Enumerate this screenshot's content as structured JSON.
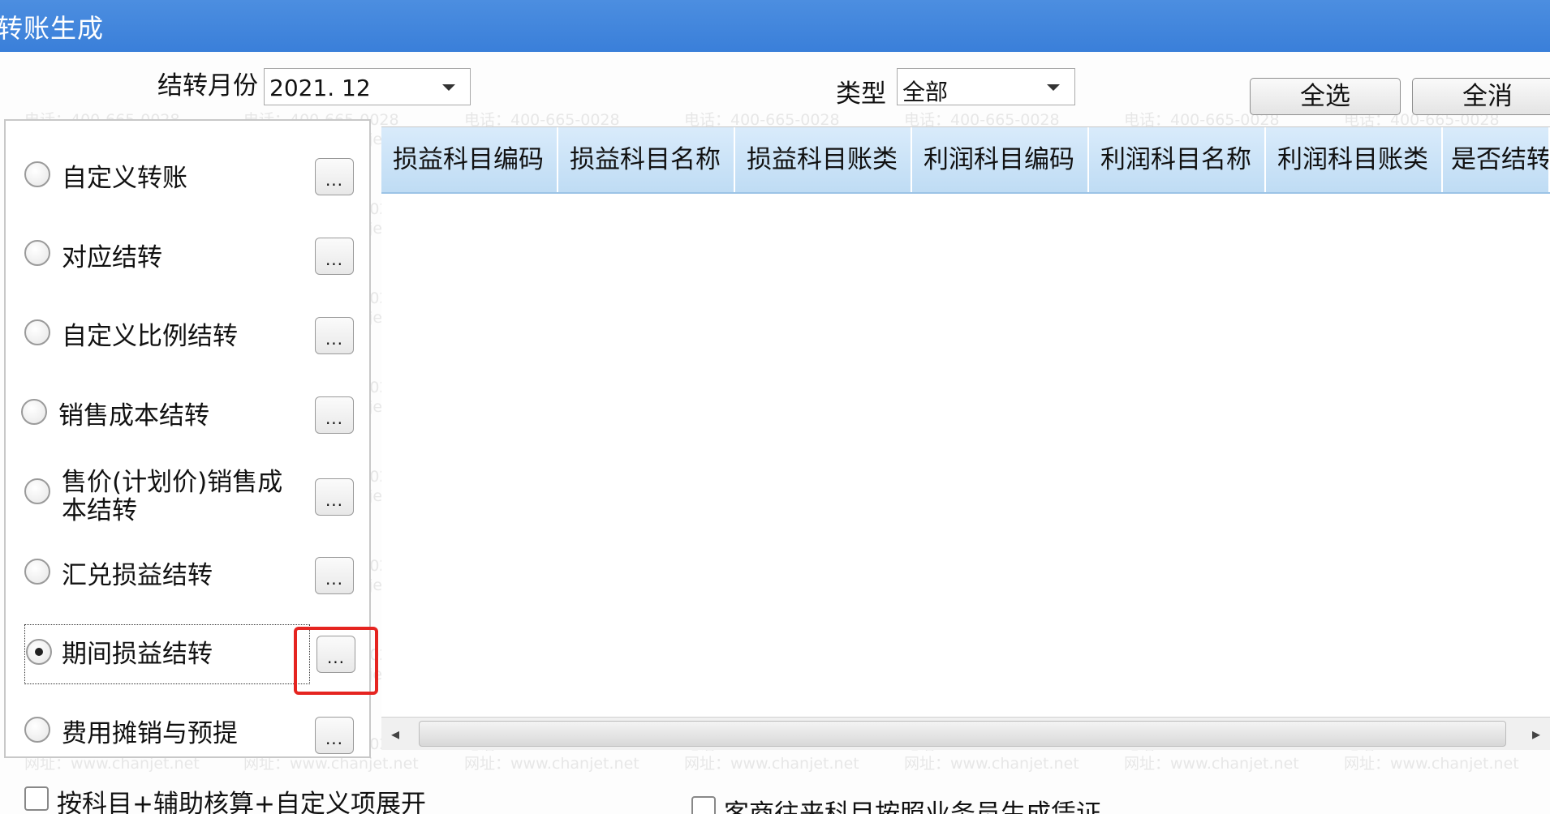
{
  "window": {
    "title": "转账生成"
  },
  "toolbar": {
    "month_label": "结转月份",
    "month_value": "2021. 12",
    "type_label": "类型",
    "type_value": "全部",
    "select_all": "全选",
    "deselect_all": "全消"
  },
  "options": [
    {
      "label": "自定义转账",
      "checked": false
    },
    {
      "label": "对应结转",
      "checked": false
    },
    {
      "label": "自定义比例结转",
      "checked": false
    },
    {
      "label": "销售成本结转",
      "checked": false
    },
    {
      "label": "售价(计划价)销售成本结转",
      "checked": false
    },
    {
      "label": "汇兑损益结转",
      "checked": false
    },
    {
      "label": "期间损益结转",
      "checked": true
    },
    {
      "label": "费用摊销与预提",
      "checked": false
    }
  ],
  "dots_label": "...",
  "table": {
    "columns": [
      "损益科目编码",
      "损益科目名称",
      "损益科目账类",
      "利润科目编码",
      "利润科目名称",
      "利润科目账类",
      "是否结转"
    ]
  },
  "footer": {
    "expand_checkbox": "按科目+辅助核算+自定义项展开",
    "vendor_checkbox": "客商往来科目按照业务员生成凭证"
  },
  "scrollbar": {
    "left_arrow": "◂",
    "right_arrow": "▸"
  },
  "watermark": {
    "phone": "电话：400-665-0028",
    "site": "网址：www.chanjet.net"
  }
}
